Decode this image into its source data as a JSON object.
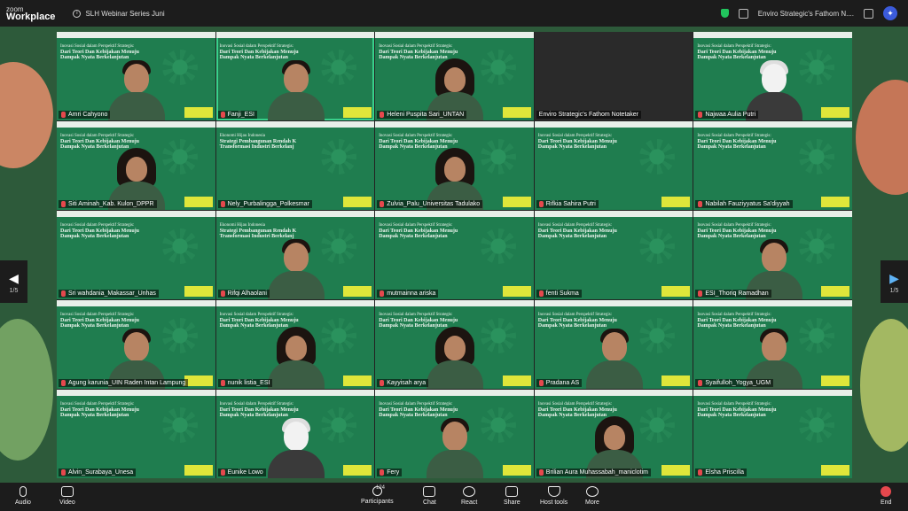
{
  "app": {
    "logo_line1": "zoom",
    "logo_line2": "Workplace"
  },
  "meeting": {
    "title": "SLH Webinar Series Juni"
  },
  "top_right": {
    "recording_label": "Enviro Strategic's Fathom N...."
  },
  "slide": {
    "line1": "Inovasi Sosial dalam Perspektif Strategis:",
    "line2": "Dari Teori Dan Kebijakan Menuju",
    "line3": "Dampak Nyata Berkelanjutan",
    "alt_line1": "Ekonomi Hijau Indonesia",
    "alt_line2": "Strategi Pembangunan Rendah K",
    "alt_line3": "Transformasi Industri Berkelanj"
  },
  "tiles": [
    {
      "name": "Amri Cahyono",
      "kind": "person"
    },
    {
      "name": "Fanji_ESI",
      "kind": "person",
      "active": true
    },
    {
      "name": "Heleni Puspita Sari_UNTAN",
      "kind": "hijab"
    },
    {
      "name": "Enviro Strategic's Fathom Notetaker",
      "kind": "dark"
    },
    {
      "name": "Najwaa Aulia Putri",
      "kind": "avatar"
    },
    {
      "name": "Siti Aminah_Kab. Kulon_DPPR",
      "kind": "hijab"
    },
    {
      "name": "Nely_Purbalingga_Polkesmar",
      "kind": "slide"
    },
    {
      "name": "Zulvia_Palu_Universitas Tadulako",
      "kind": "hijab"
    },
    {
      "name": "Rifkia Sahira Putri",
      "kind": "slide"
    },
    {
      "name": "Nabilah Fauziyyatus Sa'diyyah",
      "kind": "slide"
    },
    {
      "name": "Sri wahdania_Makassar_Unhas",
      "kind": "slide"
    },
    {
      "name": "Rifqi Alhaolani",
      "kind": "person"
    },
    {
      "name": "mutmainna ariska",
      "kind": "slide"
    },
    {
      "name": "fenti Sukma",
      "kind": "slide"
    },
    {
      "name": "ESI_Thoriq Ramadhan",
      "kind": "person"
    },
    {
      "name": "Agung karunia_UIN Raden Intan Lampung",
      "kind": "person"
    },
    {
      "name": "nunik listia_ESI",
      "kind": "hijab"
    },
    {
      "name": "Kayyisah arya",
      "kind": "hijab"
    },
    {
      "name": "Pradana AS",
      "kind": "person"
    },
    {
      "name": "Syaifulloh_Yogya_UGM",
      "kind": "person"
    },
    {
      "name": "Alvin_Surabaya_Unesa",
      "kind": "slide"
    },
    {
      "name": "Eunike Lowo",
      "kind": "avatar"
    },
    {
      "name": "Fery",
      "kind": "person"
    },
    {
      "name": "Brilian Aura Muhassabah_maniclotim",
      "kind": "hijab"
    },
    {
      "name": "Elsha Priscilla",
      "kind": "slide"
    }
  ],
  "pager": {
    "left": "1/5",
    "right": "1/5"
  },
  "toolbar": {
    "audio": "Audio",
    "video": "Video",
    "participants": "Participants",
    "participants_count": "124",
    "chat": "Chat",
    "react": "React",
    "share": "Share",
    "host_tools": "Host tools",
    "more": "More",
    "end": "End"
  },
  "colors": {
    "accent": "#39d08b",
    "end": "#e5484d",
    "slide_green": "#1f7d4f"
  }
}
